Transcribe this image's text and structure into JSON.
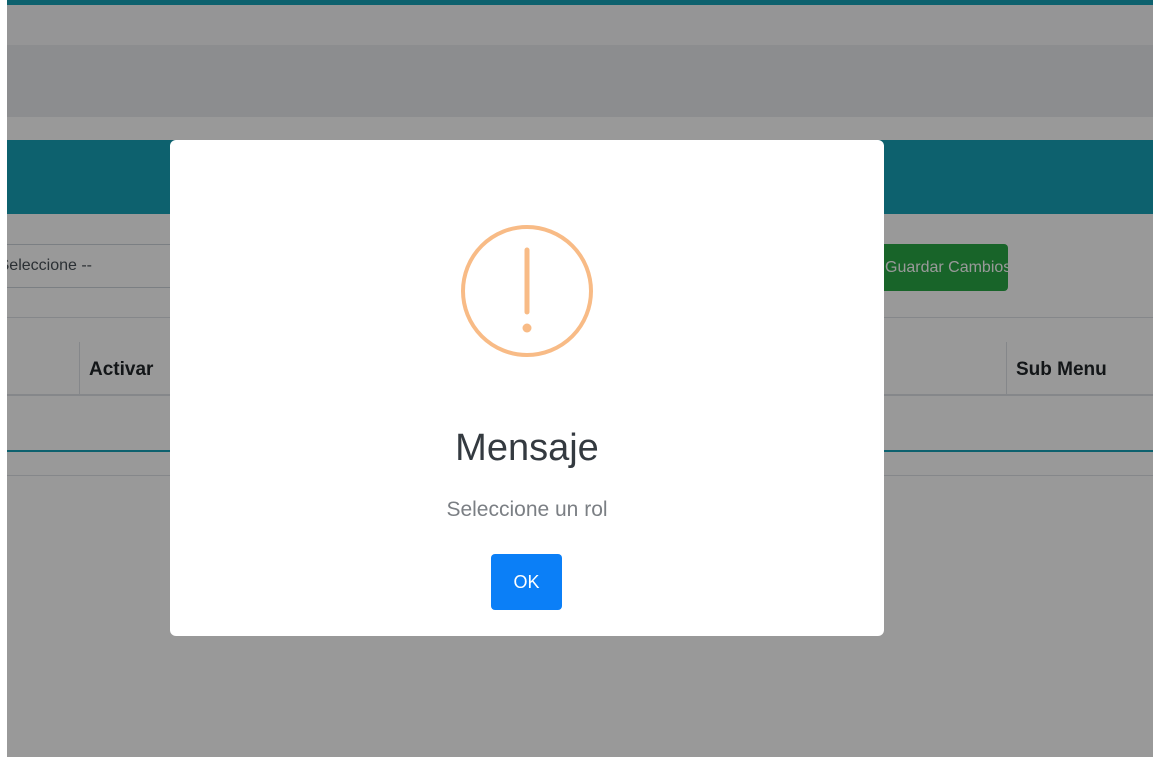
{
  "background": {
    "role_select_value": "-- Seleccione --",
    "save_button_label": "Guardar Cambios",
    "table_headers": {
      "activar": "Activar",
      "sub_menu": "Sub Menu"
    }
  },
  "dialog": {
    "icon": "warning-exclamation-icon",
    "title": "Mensaje",
    "message": "Seleccione un rol",
    "ok_label": "OK"
  },
  "colors": {
    "accent_teal": "#17a2b8",
    "save_green": "#28a745",
    "ok_blue": "#0b7ff7",
    "warning_orange": "#f8bb86"
  }
}
